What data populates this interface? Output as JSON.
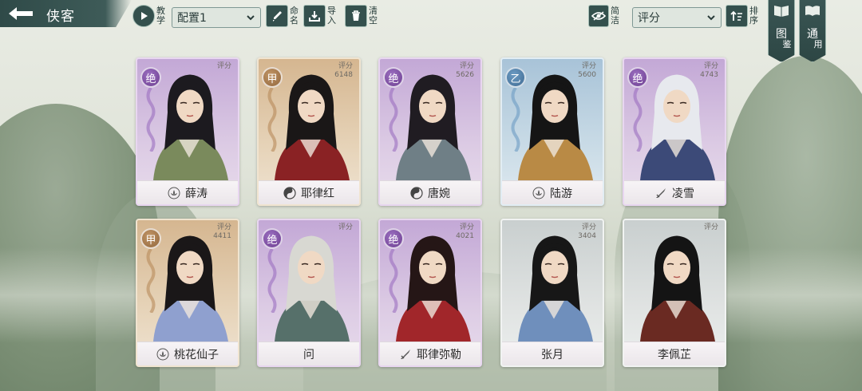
{
  "header": {
    "title": "侠客",
    "tutorial_label": "教学",
    "config_value": "配置1",
    "rename_label": "命名",
    "import_label": "导入",
    "clear_label": "清空",
    "simple_label": "简洁",
    "sort_value": "评分",
    "order_label": "排序",
    "gallery_label_1": "图",
    "gallery_label_2": "鉴",
    "common_label_1": "通",
    "common_label_2": "用"
  },
  "cards": [
    {
      "name": "薛涛",
      "grade": "绝",
      "grade_type": "jue",
      "score_label": "评分",
      "score": "",
      "icon": "lotus-icon",
      "hair": "#1c1a1f",
      "robe": "#7a8a5c"
    },
    {
      "name": "耶律红",
      "grade": "甲",
      "grade_type": "jia",
      "score_label": "评分",
      "score": "6148",
      "icon": "swirl-icon",
      "hair": "#1a1717",
      "robe": "#8a2224"
    },
    {
      "name": "唐婉",
      "grade": "绝",
      "grade_type": "jue",
      "score_label": "评分",
      "score": "5626",
      "icon": "swirl-icon",
      "hair": "#201c22",
      "robe": "#6f7f86"
    },
    {
      "name": "陆游",
      "grade": "乙",
      "grade_type": "yi",
      "score_label": "评分",
      "score": "5600",
      "icon": "lotus-icon",
      "hair": "#151515",
      "robe": "#b98a45"
    },
    {
      "name": "凌雪",
      "grade": "绝",
      "grade_type": "jue",
      "score_label": "评分",
      "score": "4743",
      "icon": "sword-icon",
      "hair": "#e7e9ee",
      "robe": "#3c4a78"
    },
    {
      "name": "桃花仙子",
      "grade": "甲",
      "grade_type": "jia",
      "score_label": "评分",
      "score": "4411",
      "icon": "lotus-icon",
      "hair": "#1a1718",
      "robe": "#8fa0cf"
    },
    {
      "name": "问",
      "grade": "绝",
      "grade_type": "jue",
      "score_label": "评分",
      "score": "",
      "icon": "",
      "hair": "#d8d8d2",
      "robe": "#56706a"
    },
    {
      "name": "耶律弥勒",
      "grade": "绝",
      "grade_type": "jue",
      "score_label": "评分",
      "score": "4021",
      "icon": "sword-icon",
      "hair": "#251616",
      "robe": "#a1262a"
    },
    {
      "name": "张月",
      "grade": "",
      "grade_type": "none",
      "score_label": "评分",
      "score": "3404",
      "icon": "",
      "hair": "#171717",
      "robe": "#6f8fbc"
    },
    {
      "name": "李佩芷",
      "grade": "",
      "grade_type": "none",
      "score_label": "评分",
      "score": "",
      "icon": "",
      "hair": "#141414",
      "robe": "#6a2a22"
    }
  ],
  "colors": {
    "panel": "#34504d",
    "accent_border": "#a9c2b9"
  }
}
